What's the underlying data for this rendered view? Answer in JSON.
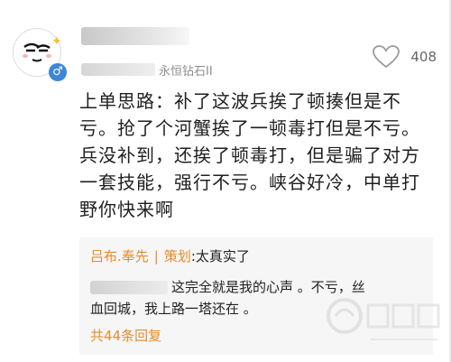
{
  "author": {
    "rank_label": "永恒钻石II",
    "gender_symbol": "♂",
    "star_symbol": "✦"
  },
  "likes": {
    "count": "408",
    "icon": "heart-icon"
  },
  "post": {
    "text": "上单思路：补了这波兵挨了顿揍但是不亏。抢了个河蟹挨了一顿毒打但是不亏。兵没补到，还挨了顿毒打，但是骗了对方一套技能，强行不亏。峡谷好冷，中单打野你快来啊"
  },
  "reply": {
    "name": "吕布.奉先",
    "separator": "|",
    "role": "策划",
    "colon": ":",
    "quote": "太真实了",
    "line1": "这完全就是我的心声 。不亏，丝",
    "line2": "血回城，我上路一塔还在 。",
    "count": "共44条回复"
  },
  "colors": {
    "accent": "#e48d2e",
    "gender": "#3f86d8",
    "star": "#f4c22a"
  }
}
